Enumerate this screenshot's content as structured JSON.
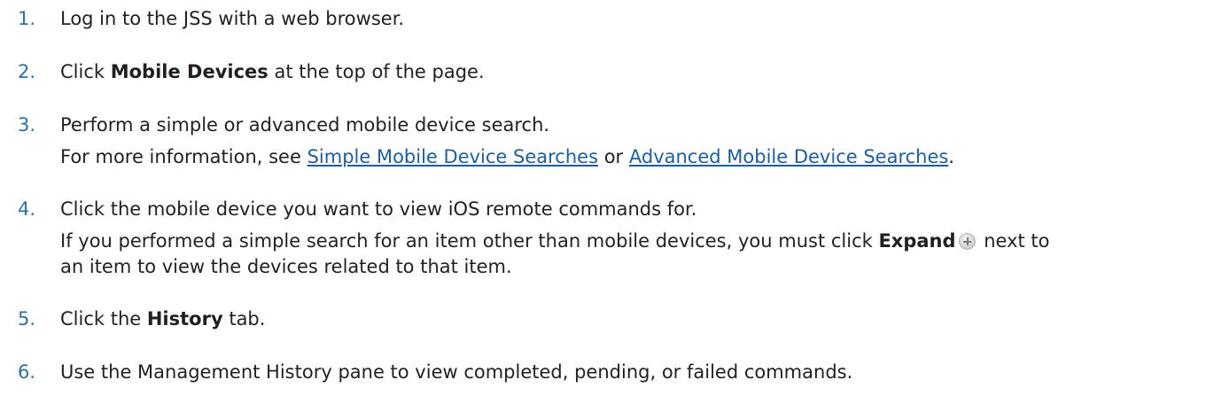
{
  "steps": [
    {
      "number": "1.",
      "text": "Log in to the JSS with a web browser."
    },
    {
      "number": "2.",
      "pre": "Click ",
      "bold": "Mobile Devices",
      "post": " at the top of the page."
    },
    {
      "number": "3.",
      "text": "Perform a simple or advanced mobile device search.",
      "sub_pre": "For more information, see ",
      "link1": "Simple Mobile Device Searches",
      "sub_mid": " or ",
      "link2": "Advanced Mobile Device Searches",
      "sub_post": "."
    },
    {
      "number": "4.",
      "text": "Click the mobile device you want to view iOS remote commands for.",
      "sub_pre": "If you performed a simple search for an item other than mobile devices, you must click ",
      "bold": "Expand",
      "sub_post": " next to",
      "sub_line2": "an item to view the devices related to that item."
    },
    {
      "number": "5.",
      "pre": "Click the ",
      "bold": "History",
      "post": " tab."
    },
    {
      "number": "6.",
      "text": "Use the Management History pane to view completed, pending, or failed commands."
    }
  ],
  "icons": {
    "expand": "plus-circle-icon"
  }
}
